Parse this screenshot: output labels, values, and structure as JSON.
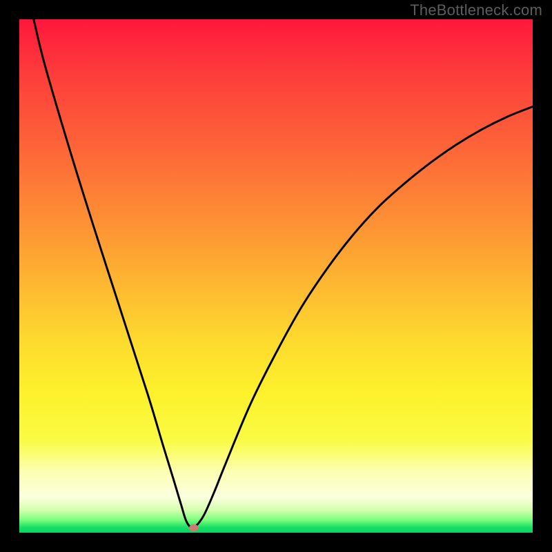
{
  "watermark": "TheBottleneck.com",
  "accent_marker_color": "#cf7a72",
  "chart_data": {
    "type": "line",
    "title": "",
    "xlabel": "",
    "ylabel": "",
    "xlim": [
      0,
      100
    ],
    "ylim": [
      0,
      100
    ],
    "series": [
      {
        "name": "bottleneck-curve",
        "x": [
          2.8,
          5,
          10,
          15,
          20,
          25,
          28,
          30,
          31.5,
          32.5,
          33.5,
          34.5,
          36,
          38,
          40,
          45,
          50,
          55,
          60,
          65,
          70,
          75,
          80,
          85,
          90,
          95,
          100
        ],
        "values": [
          100,
          91,
          74,
          58,
          42.5,
          27,
          17,
          10.5,
          5.5,
          2.3,
          1.0,
          1.4,
          3.5,
          8,
          13,
          25,
          35,
          44,
          51.5,
          58,
          63.5,
          68,
          72,
          75.5,
          78.5,
          81,
          83
        ]
      }
    ],
    "marker": {
      "x": 34.0,
      "y": 1.0
    },
    "background_gradient": [
      "#fe173c",
      "#fd9234",
      "#fdf22c",
      "#fbffde",
      "#03d864"
    ]
  }
}
